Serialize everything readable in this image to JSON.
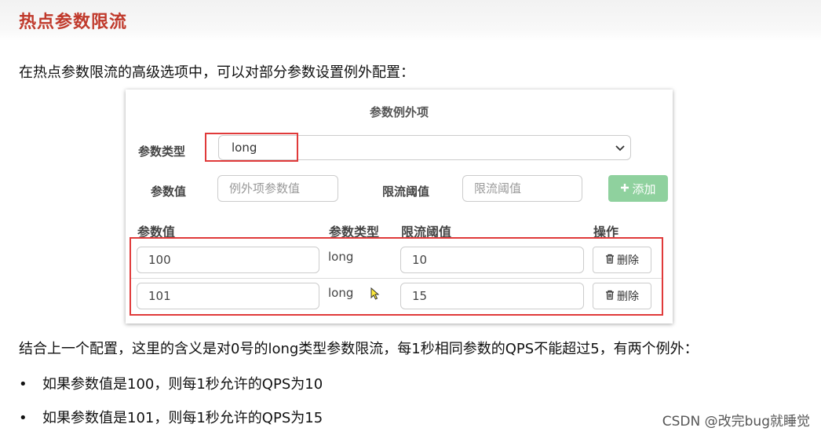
{
  "page_title": "热点参数限流",
  "intro": "在热点参数限流的高级选项中，可以对部分参数设置例外配置：",
  "panel": {
    "heading": "参数例外项",
    "param_type_label": "参数类型",
    "param_type_value": "long",
    "param_value_label": "参数值",
    "param_value_placeholder": "例外项参数值",
    "threshold_label": "限流阈值",
    "threshold_placeholder": "限流阈值",
    "add_button": "添加",
    "table": {
      "headers": [
        "参数值",
        "参数类型",
        "限流阈值",
        "操作"
      ],
      "rows": [
        {
          "value": "100",
          "type": "long",
          "threshold": "10",
          "action": "删除"
        },
        {
          "value": "101",
          "type": "long",
          "threshold": "15",
          "action": "删除"
        }
      ]
    }
  },
  "explanation": "结合上一个配置，这里的含义是对0号的long类型参数限流，每1秒相同参数的QPS不能超过5，有两个例外：",
  "bullets": [
    "如果参数值是100，则每1秒允许的QPS为10",
    "如果参数值是101，则每1秒允许的QPS为15"
  ],
  "watermark": "CSDN @改完bug就睡觉",
  "colors": {
    "title_red": "#c0392b",
    "highlight_border": "#e03a3a",
    "add_button_green": "#8fd19e"
  }
}
